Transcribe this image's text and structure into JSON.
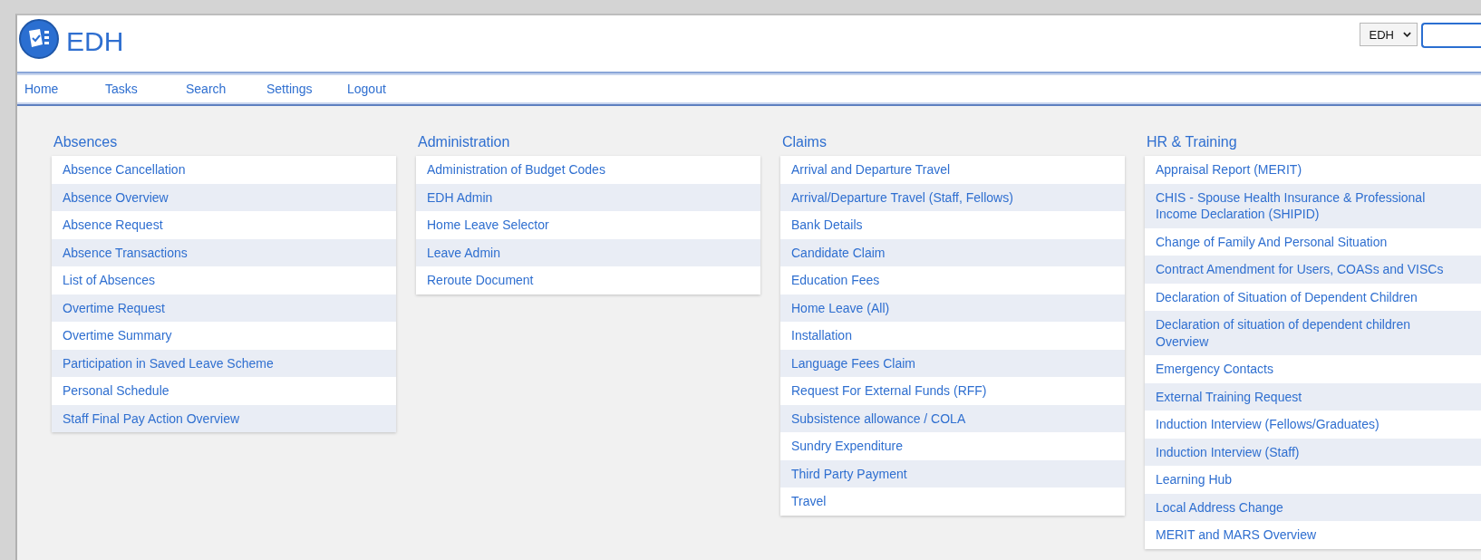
{
  "header": {
    "app_name": "EDH",
    "selector": {
      "value": "EDH"
    }
  },
  "nav": [
    {
      "label": "Home"
    },
    {
      "label": "Tasks"
    },
    {
      "label": "Search"
    },
    {
      "label": "Settings"
    },
    {
      "label": "Logout"
    }
  ],
  "sections": [
    {
      "title": "Absences",
      "items": [
        "Absence Cancellation",
        "Absence Overview",
        "Absence Request",
        "Absence Transactions",
        "List of Absences",
        "Overtime Request",
        "Overtime Summary",
        "Participation in Saved Leave Scheme",
        "Personal Schedule",
        "Staff Final Pay Action Overview"
      ]
    },
    {
      "title": "Administration",
      "items": [
        "Administration of Budget Codes",
        "EDH Admin",
        "Home Leave Selector",
        "Leave Admin",
        "Reroute Document"
      ]
    },
    {
      "title": "Claims",
      "items": [
        "Arrival and Departure Travel",
        "Arrival/Departure Travel (Staff, Fellows)",
        "Bank Details",
        "Candidate Claim",
        "Education Fees",
        "Home Leave (All)",
        "Installation",
        "Language Fees Claim",
        "Request For External Funds (RFF)",
        "Subsistence allowance / COLA",
        "Sundry Expenditure",
        "Third Party Payment",
        "Travel"
      ]
    },
    {
      "title": "HR & Training",
      "items": [
        "Appraisal Report (MERIT)",
        "CHIS - Spouse Health Insurance & Professional Income Declaration (SHIPID)",
        "Change of Family And Personal Situation",
        "Contract Amendment for Users, COASs and VISCs",
        "Declaration of Situation of Dependent Children",
        "Declaration of situation of dependent children Overview",
        "Emergency Contacts",
        "External Training Request",
        "Induction Interview (Fellows/Graduates)",
        "Induction Interview (Staff)",
        "Learning Hub",
        "Local Address Change",
        "MERIT and MARS Overview"
      ]
    }
  ]
}
